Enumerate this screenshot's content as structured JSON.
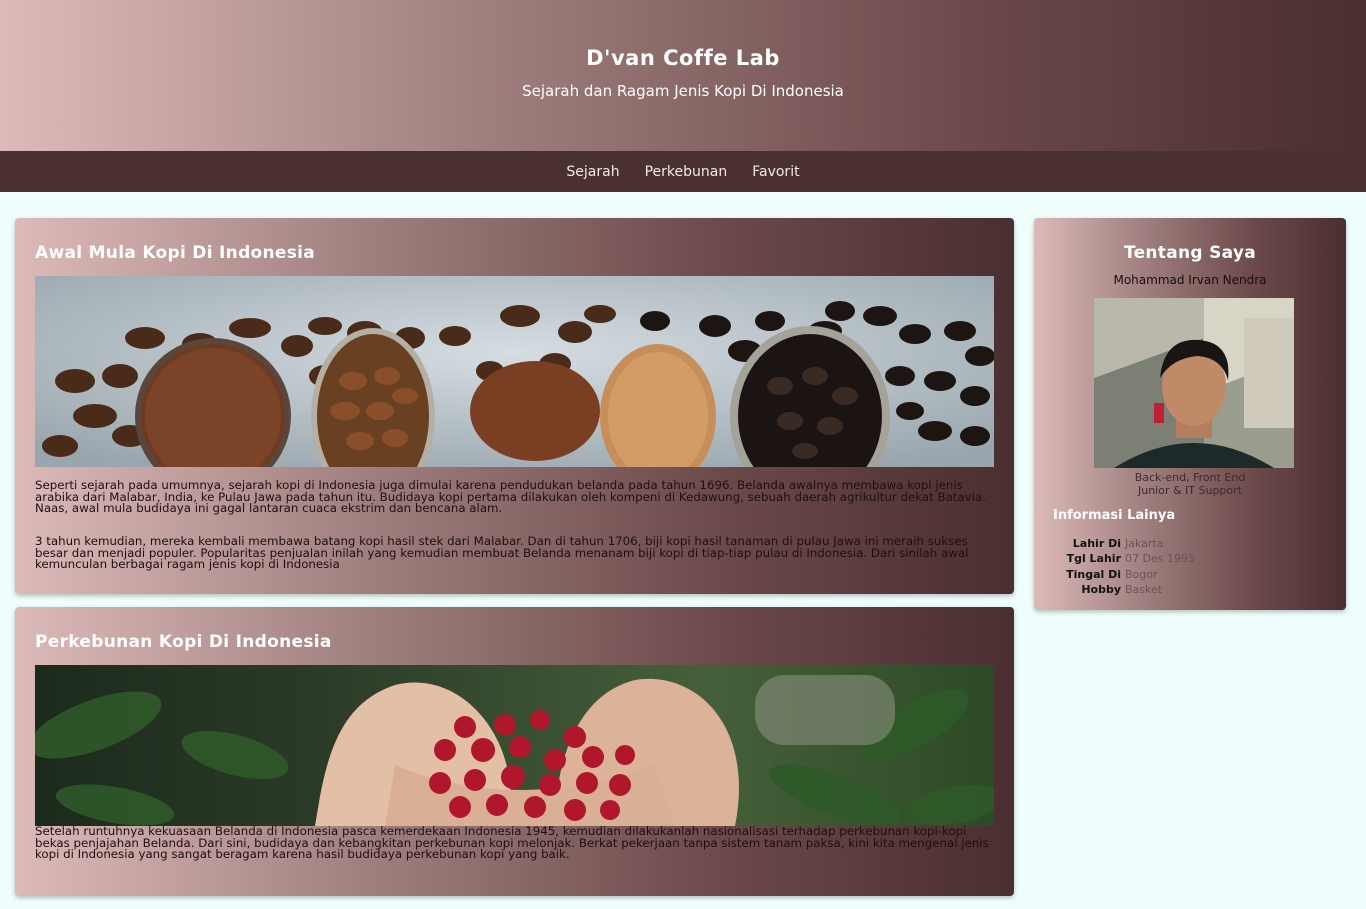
{
  "header": {
    "title": "D'van Coffe Lab",
    "subtitle": "Sejarah dan Ragam Jenis Kopi Di Indonesia"
  },
  "nav": {
    "items": [
      {
        "label": "Sejarah"
      },
      {
        "label": "Perkebunan"
      },
      {
        "label": "Favorit"
      }
    ]
  },
  "articles": [
    {
      "title": "Awal Mula Kopi Di Indonesia",
      "paragraphs": [
        "Seperti sejarah pada umumnya, sejarah kopi di Indonesia juga dimulai karena pendudukan belanda pada tahun 1696. Belanda awalnya membawa kopi jenis arabika dari Malabar, India, ke Pulau Jawa pada tahun itu. Budidaya kopi pertama dilakukan oleh kompeni di Kedawung, sebuah daerah agrikultur dekat Batavia. Naas, awal mula budidaya ini gagal lantaran cuaca ekstrim dan bencana alam.",
        "3 tahun kemudian, mereka kembali membawa batang kopi hasil stek dari Malabar. Dan di tahun 1706, biji kopi hasil tanaman di pulau Jawa ini meraih sukses besar dan menjadi populer. Popularitas penjualan inilah yang kemudian membuat Belanda menanam biji kopi di tiap-tiap pulau di Indonesia. Dari sinilah awal kemunculan berbagai ragam jenis kopi di Indonesia"
      ]
    },
    {
      "title": "Perkebunan Kopi Di Indonesia",
      "paragraphs": [
        "Setelah runtuhnya kekuasaan Belanda di Indonesia pasca kemerdekaan Indonesia 1945, kemudian dilakukanlah nasionalisasi terhadap perkebunan kopi-kopi bekas penjajahan Belanda. Dari sini, budidaya dan kebangkitan perkebunan kopi melonjak. Berkat pekerjaan tanpa sistem tanam paksa, kini kita mengenal jenis kopi di Indonesia yang sangat beragam karena hasil budidaya perkebunan kopi yang baik."
      ]
    }
  ],
  "sidebar": {
    "title": "Tentang Saya",
    "name": "Mohammad Irvan Nendra",
    "role_line1": "Back-end, Front End",
    "role_line2": "Junior & IT Support",
    "info_title": "Informasi Lainya",
    "info": [
      {
        "key": "Lahir Di",
        "value": "Jakarta"
      },
      {
        "key": "Tgl Lahir",
        "value": "07 Des 1995"
      },
      {
        "key": "Tingal Di",
        "value": "Bogor"
      },
      {
        "key": "Hobby",
        "value": "Basket"
      }
    ]
  }
}
